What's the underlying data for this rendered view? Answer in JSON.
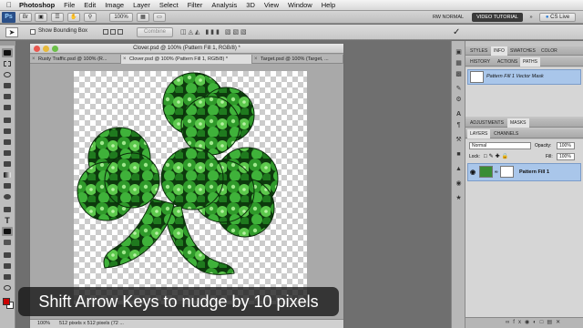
{
  "menubar": {
    "app_name": "Photoshop",
    "items": [
      "File",
      "Edit",
      "Image",
      "Layer",
      "Select",
      "Filter",
      "Analysis",
      "3D",
      "View",
      "Window",
      "Help"
    ]
  },
  "appbar": {
    "logo": "Ps",
    "zoom": "100%",
    "workspace_label": "RW NORMAL",
    "video_tutorial_label": "VIDEO TUTORIAL",
    "cslive_label": "CS Live"
  },
  "options": {
    "show_bounding_box_label": "Show Bounding Box",
    "combine_label": "Combine"
  },
  "document": {
    "title": "Clover.psd @ 100% (Pattern Fill 1, RGB/8) *",
    "tabs": [
      {
        "label": "Rusty Traffic.psd @ 100% (R..."
      },
      {
        "label": "Clover.psd @ 100% (Pattern Fill 1, RGB/8) *"
      },
      {
        "label": "Target.psd @ 100% (Target, ..."
      }
    ],
    "status_zoom": "100%",
    "status_info": "512 pixels x 512 pixels (72 ..."
  },
  "panels": {
    "top_tabs": [
      "STYLES",
      "INFO",
      "SWATCHES",
      "COLOR"
    ],
    "history_tabs": [
      "HISTORY",
      "ACTIONS",
      "PATHS"
    ],
    "history_item": "Pattern Fill 1 Vector Mask",
    "adjust_tabs": [
      "ADJUSTMENTS",
      "MASKS"
    ],
    "layer_tabs": [
      "LAYERS",
      "CHANNELS"
    ],
    "blend_mode": "Normal",
    "opacity_label": "Opacity:",
    "opacity_value": "100%",
    "lock_label": "Lock:",
    "fill_label": "Fill:",
    "fill_value": "100%",
    "layer_name": "Pattern Fill 1"
  },
  "caption": "Shift Arrow Keys to nudge by 10 pixels"
}
